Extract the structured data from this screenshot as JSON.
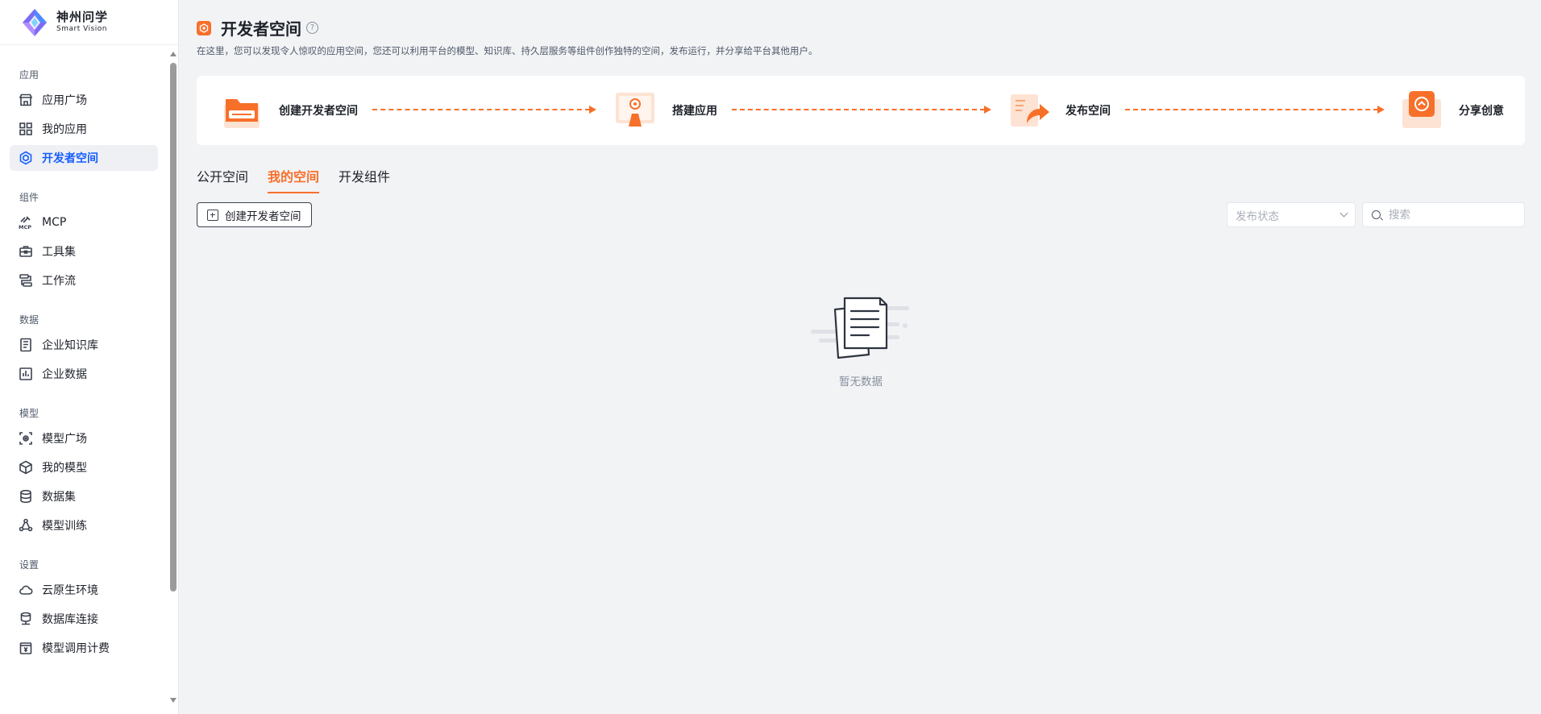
{
  "brand": {
    "name_cn": "神州问学",
    "name_en": "Smart Vision"
  },
  "sidebar": {
    "groups": [
      {
        "title": "应用",
        "items": [
          {
            "label": "应用广场",
            "icon": "store-icon"
          },
          {
            "label": "我的应用",
            "icon": "grid-icon"
          },
          {
            "label": "开发者空间",
            "icon": "hexagon-cube-icon",
            "active": true
          }
        ]
      },
      {
        "title": "组件",
        "items": [
          {
            "label": "MCP",
            "icon": "mcp-icon"
          },
          {
            "label": "工具集",
            "icon": "toolbox-icon"
          },
          {
            "label": "工作流",
            "icon": "workflow-icon"
          }
        ]
      },
      {
        "title": "数据",
        "items": [
          {
            "label": "企业知识库",
            "icon": "knowledge-base-icon"
          },
          {
            "label": "企业数据",
            "icon": "bar-chart-icon"
          }
        ]
      },
      {
        "title": "模型",
        "items": [
          {
            "label": "模型广场",
            "icon": "model-square-icon"
          },
          {
            "label": "我的模型",
            "icon": "cube-icon"
          },
          {
            "label": "数据集",
            "icon": "database-icon"
          },
          {
            "label": "模型训练",
            "icon": "training-icon"
          }
        ]
      },
      {
        "title": "设置",
        "items": [
          {
            "label": "云原生环境",
            "icon": "cloud-icon"
          },
          {
            "label": "数据库连接",
            "icon": "db-connect-icon"
          },
          {
            "label": "模型调用计费",
            "icon": "billing-icon"
          }
        ]
      }
    ]
  },
  "header": {
    "title": "开发者空间",
    "help_symbol": "?",
    "description": "在这里，您可以发现令人惊叹的应用空间，您还可以利用平台的模型、知识库、持久层服务等组件创作独特的空间，发布运行，并分享给平台其他用户。"
  },
  "steps": [
    {
      "label": "创建开发者空间",
      "icon": "folder-create-icon"
    },
    {
      "label": "搭建应用",
      "icon": "build-app-icon"
    },
    {
      "label": "发布空间",
      "icon": "publish-share-icon"
    },
    {
      "label": "分享创意",
      "icon": "share-idea-icon"
    }
  ],
  "tabs": [
    {
      "label": "公开空间",
      "active": false
    },
    {
      "label": "我的空间",
      "active": true
    },
    {
      "label": "开发组件",
      "active": false
    }
  ],
  "toolbar": {
    "create_label": "创建开发者空间",
    "status_placeholder": "发布状态",
    "search_placeholder": "搜索"
  },
  "empty_state": {
    "label": "暂无数据",
    "icon": "empty-documents-icon"
  },
  "colors": {
    "accent": "#f7702a",
    "active_nav": "#165dff",
    "bg": "#f2f3f5"
  }
}
